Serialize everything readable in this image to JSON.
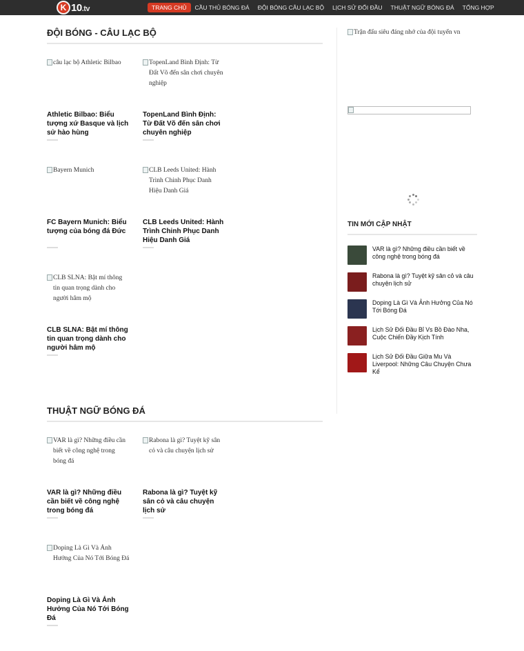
{
  "header": {
    "logo_k": "K",
    "logo_text": "10",
    "logo_tv": ".tv",
    "nav": [
      {
        "label": "TRANG CHỦ",
        "active": true
      },
      {
        "label": "CẦU THỦ BÓNG ĐÁ",
        "active": false
      },
      {
        "label": "ĐỘI BÓNG CÂU LẠC BỘ",
        "active": false
      },
      {
        "label": "LỊCH SỬ ĐỐI ĐẦU",
        "active": false
      },
      {
        "label": "THUẬT NGỮ BÓNG ĐÁ",
        "active": false
      },
      {
        "label": "TỔNG HỢP",
        "active": false
      }
    ]
  },
  "sections": [
    {
      "title": "ĐỘI BÓNG - CÂU LẠC BỘ",
      "cards": [
        {
          "alt": "câu lạc bộ Athletic Bilbao",
          "title": "Athletic Bilbao: Biểu tượng xứ Basque và lịch sử hào hùng"
        },
        {
          "alt": "TopenLand Bình Định: Từ Đất Võ đến sân chơi chuyên nghiệp",
          "title": "TopenLand Bình Định: Từ Đất Võ đến sân chơi chuyên nghiệp"
        },
        {
          "alt": "Bayern Munich",
          "title": "FC Bayern Munich: Biểu tượng của bóng đá Đức"
        },
        {
          "alt": "CLB Leeds United: Hành Trình Chinh Phục Danh Hiệu Danh Giá",
          "title": "CLB Leeds United: Hành Trình Chinh Phục Danh Hiệu Danh Giá"
        },
        {
          "alt": "CLB SLNA: Bật mí thông tin quan trọng dành cho người hâm mộ",
          "title": "CLB SLNA: Bật mí thông tin quan trọng dành cho người hâm mộ"
        }
      ]
    },
    {
      "title": "THUẬT NGỮ BÓNG ĐÁ",
      "cards": [
        {
          "alt": "VAR là gì? Những điều cần biết về công nghệ trong bóng đá",
          "title": "VAR là gì? Những điều cần biết về công nghệ trong bóng đá"
        },
        {
          "alt": "Rabona là gì? Tuyệt kỹ sân cỏ và câu chuyện lịch sử",
          "title": "Rabona là gì? Tuyệt kỹ sân cỏ và câu chuyện lịch sử"
        },
        {
          "alt": "Doping Là Gì Và Ảnh Hưởng Của Nó Tới Bóng Đá",
          "title": "Doping Là Gì Và Ảnh Hưởng Của Nó Tới Bóng Đá"
        }
      ]
    }
  ],
  "sidebar": {
    "ad_alt": "Trận đấu siêu đáng nhớ của đội tuyển vn",
    "news_title": "TIN MỚI CẬP NHẬT",
    "news": [
      {
        "title": "VAR là gì? Những điều cần biết về công nghệ trong bóng đá",
        "thumb_color": "#3a4a3a"
      },
      {
        "title": "Rabona là gì? Tuyệt kỹ sân cỏ và câu chuyện lịch sử",
        "thumb_color": "#7a1d1d"
      },
      {
        "title": "Doping Là Gì Và Ảnh Hưởng Của Nó Tới Bóng Đá",
        "thumb_color": "#2b3550"
      },
      {
        "title": "Lịch Sử Đối Đầu Bỉ Vs Bồ Đào Nha, Cuộc Chiến Đầy Kịch Tính",
        "thumb_color": "#8a2020"
      },
      {
        "title": "Lịch Sử Đối Đầu Giữa Mu Và Liverpool: Những Câu Chuyện Chưa Kể",
        "thumb_color": "#a11818"
      }
    ]
  }
}
